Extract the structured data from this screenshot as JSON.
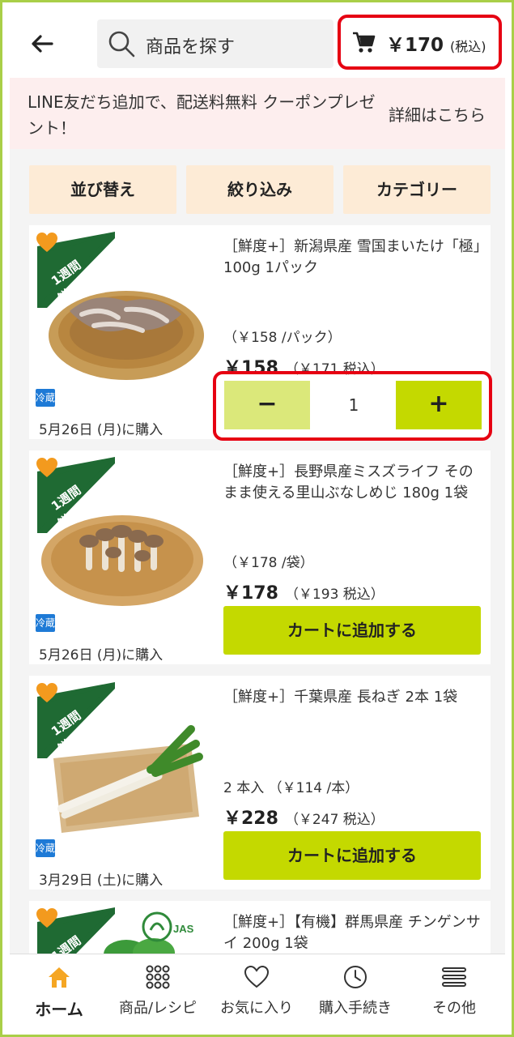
{
  "header": {
    "search_placeholder": "商品を探す",
    "cart_amount": "￥170",
    "cart_tax": "(税込)"
  },
  "banner": {
    "message": "LINE友だち追加で、配送料無料 クーポンプレゼント！",
    "link": "詳細はこちら"
  },
  "filters": [
    "並び替え",
    "絞り込み",
    "カテゴリー"
  ],
  "badge_text": "1週間 鮮度保証",
  "cold_label": "冷蔵",
  "products": [
    {
      "name": "［鮮度+］新潟県産 雪国まいたけ「極」100g 1パック",
      "unit_price": "（￥158 /パック）",
      "price": "￥158",
      "price_tax": "（￥171 税込）",
      "purchased": "5月26日 (月)に購入",
      "quantity": "1"
    },
    {
      "name": "［鮮度+］長野県産ミスズライフ そのまま使える里山ぶなしめじ 180g 1袋",
      "unit_price": "（￥178 /袋）",
      "price": "￥178",
      "price_tax": "（￥193 税込）",
      "purchased": "5月26日 (月)に購入",
      "button": "カートに追加する"
    },
    {
      "name": "［鮮度+］千葉県産 長ねぎ 2本 1袋",
      "unit_price": "2 本入 （￥114 /本）",
      "price": "￥228",
      "price_tax": "（￥247 税込）",
      "purchased": "3月29日 (土)に購入",
      "button": "カートに追加する"
    },
    {
      "name": "［鮮度+］【有機】群馬県産 チンゲンサイ 200g 1袋"
    }
  ],
  "stepper": {
    "minus": "−",
    "plus": "+"
  },
  "nav": [
    {
      "label": "ホーム",
      "icon": "home-icon",
      "active": true
    },
    {
      "label": "商品/レシピ",
      "icon": "grid-icon"
    },
    {
      "label": "お気に入り",
      "icon": "heart-icon"
    },
    {
      "label": "購入手続き",
      "icon": "clock-icon"
    },
    {
      "label": "その他",
      "icon": "menu-icon"
    }
  ],
  "colors": {
    "accent": "#c4d900",
    "highlight": "#e60012",
    "home_active": "#f5a623",
    "badge_green": "#1f6a33"
  }
}
